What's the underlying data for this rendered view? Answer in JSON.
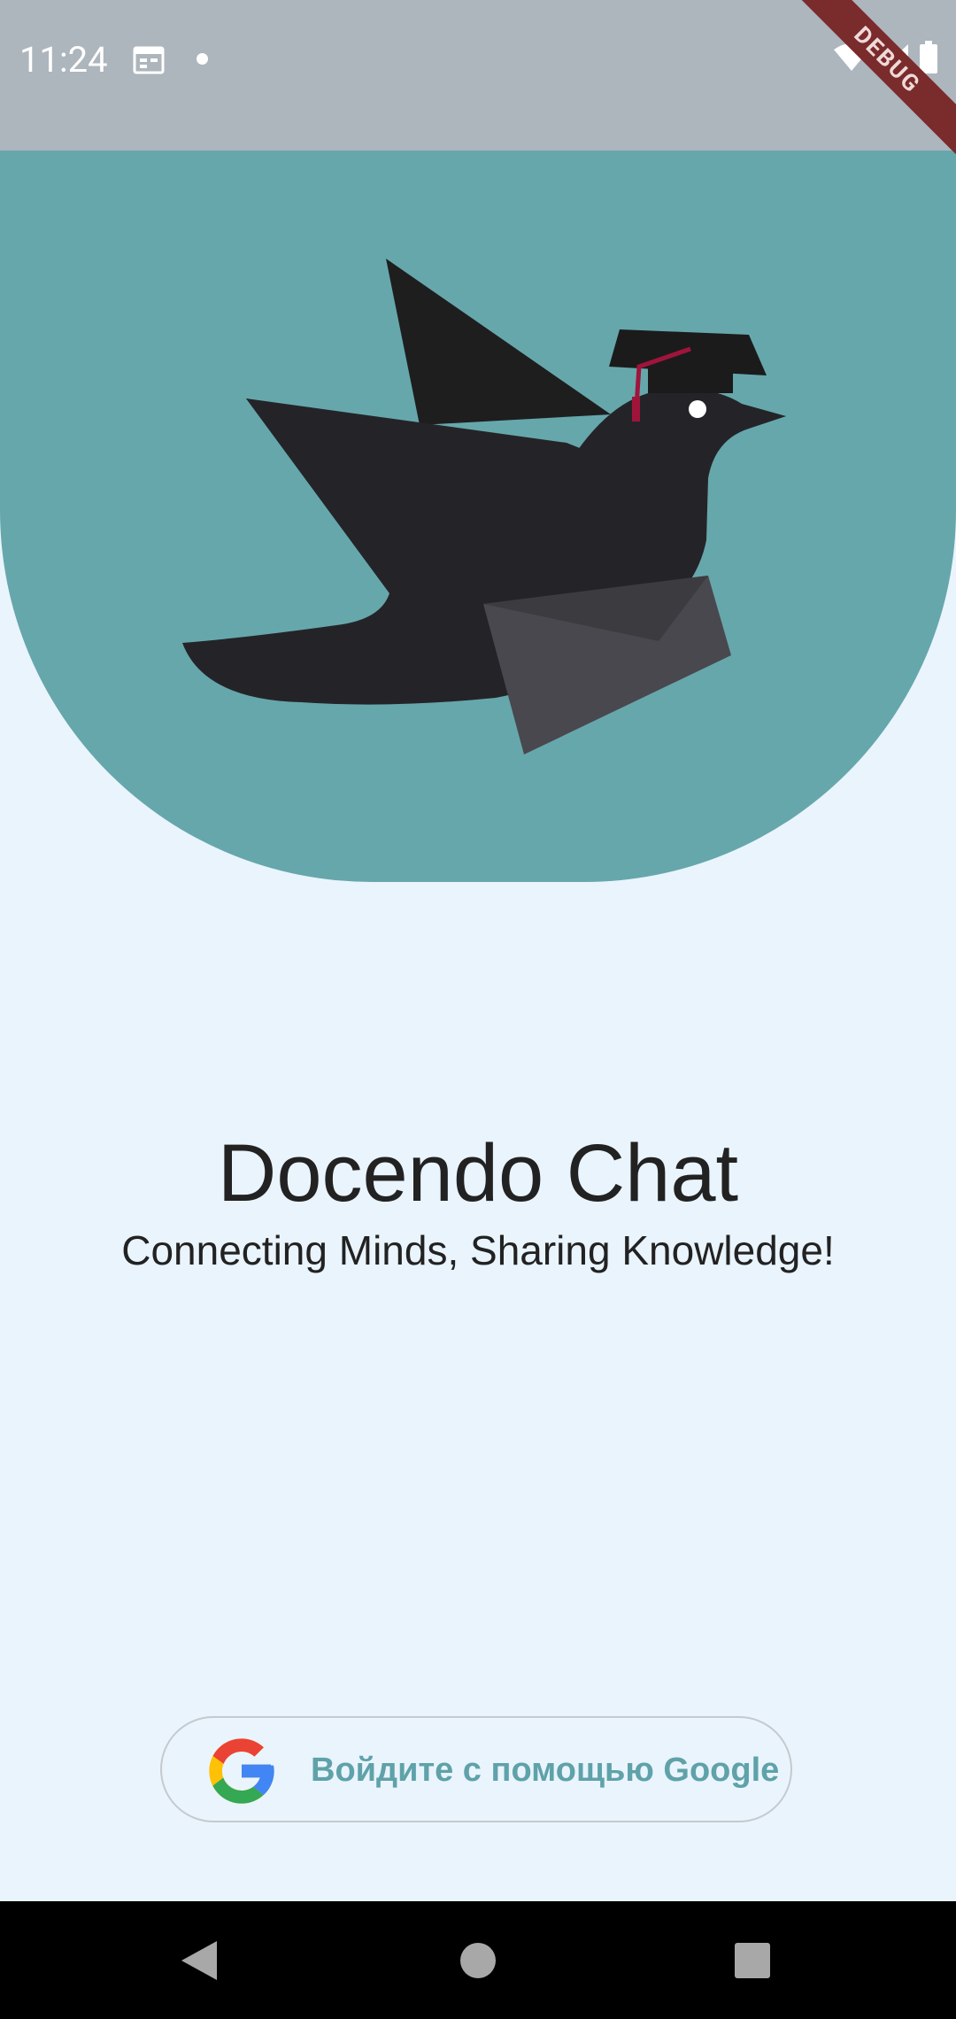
{
  "status_bar": {
    "time": "11:24",
    "icons": [
      "calendar-icon",
      "notification-dot-icon",
      "wifi-icon",
      "signal-icon",
      "battery-icon"
    ]
  },
  "debug_banner": {
    "label": "DEBUG"
  },
  "hero": {
    "illustration": "crow-with-graduation-cap-and-envelope"
  },
  "app": {
    "title": "Docendo Chat",
    "tagline": "Connecting Minds, Sharing Knowledge!"
  },
  "sign_in": {
    "label": "Войдите с помощью Google",
    "icon": "google-icon"
  },
  "nav_bar": {
    "buttons": [
      "back-icon",
      "home-icon",
      "recents-icon"
    ]
  },
  "colors": {
    "status_bar": "#ADB5BD",
    "hero": "#66A7AC",
    "background": "#EAF4FD",
    "accent_text": "#5FA2A9",
    "debug_banner": "#7A2B2B"
  }
}
